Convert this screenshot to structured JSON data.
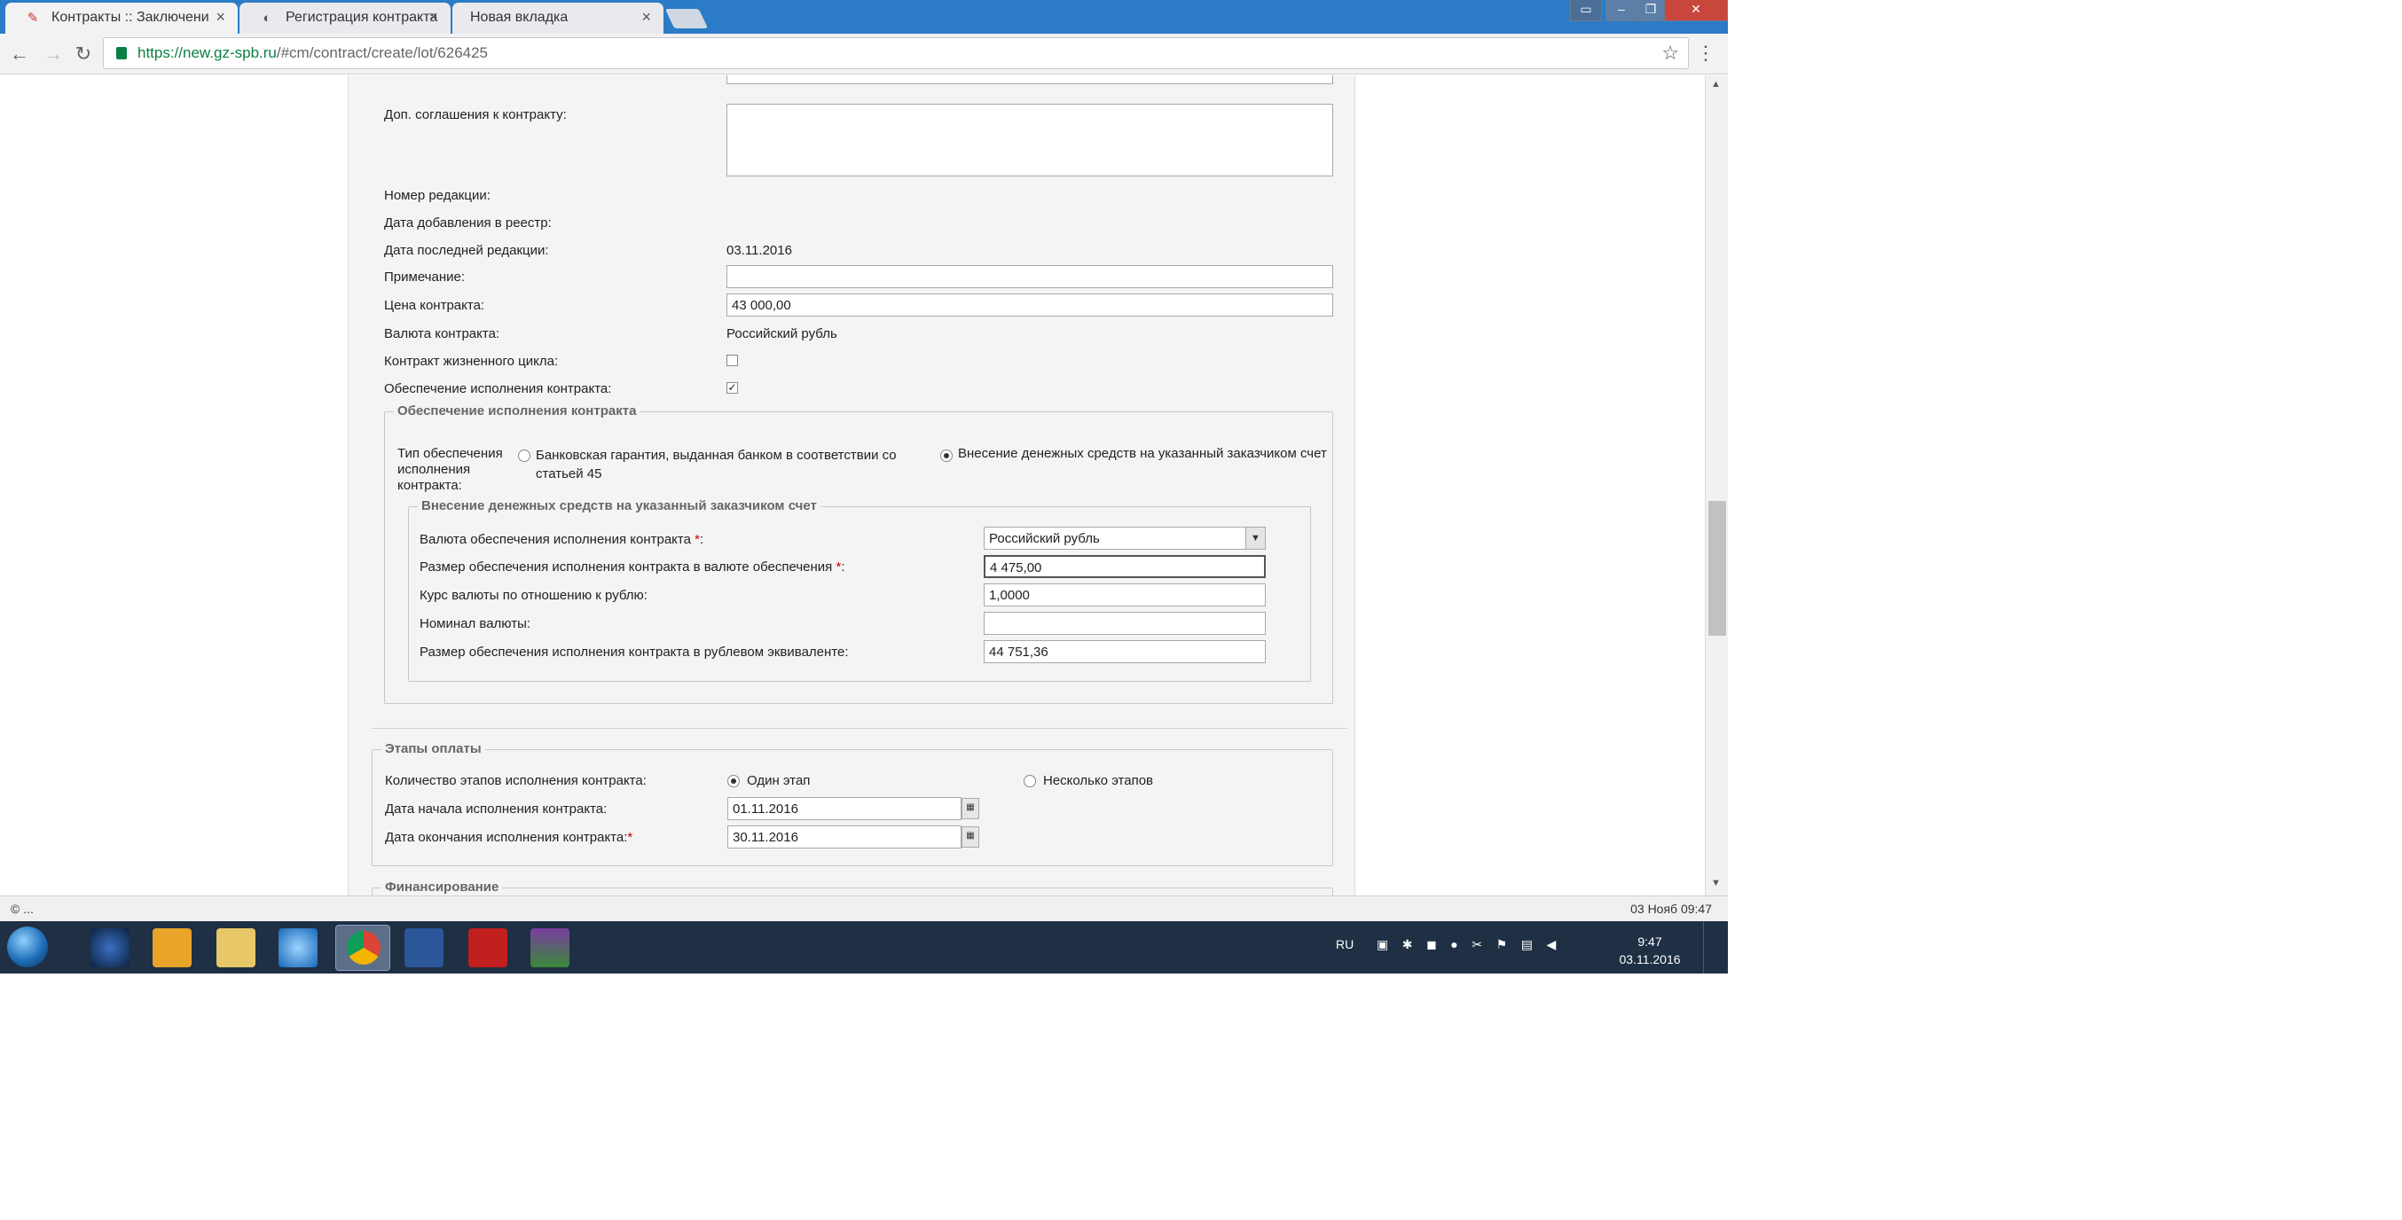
{
  "browser": {
    "tabs": [
      {
        "title": "Контракты :: Заключени",
        "active": true,
        "icon": "contract-favicon-icon"
      },
      {
        "title": "Регистрация контракта",
        "active": false,
        "icon": "globe-favicon-icon"
      },
      {
        "title": "Новая вкладка",
        "active": false,
        "icon": ""
      }
    ],
    "url_host": "https://new.gz-spb.ru",
    "url_path": "/#cm/contract/create/lot/626425"
  },
  "form": {
    "dop_label": "Доп. соглашения к контракту:",
    "nomer_label": "Номер редакции:",
    "data_dob_label": "Дата добавления в реестр:",
    "data_posl_label": "Дата последней редакции:",
    "data_posl_value": "03.11.2016",
    "primechanie_label": "Примечание:",
    "primechanie_value": "",
    "cena_label": "Цена контракта:",
    "cena_value": "43 000,00",
    "valuta_label": "Валюта контракта:",
    "valuta_value": "Российский рубль",
    "zhizn_label": "Контракт жизненного цикла:",
    "zhizn_checked": false,
    "obesp_label": "Обеспечение исполнения контракта:",
    "obesp_checked": true
  },
  "security": {
    "legend": "Обеспечение исполнения контракта",
    "type_label": "Тип обеспечения исполнения контракта:",
    "option1": "Банковская гарантия, выданная банком в соответствии со статьей 45",
    "option2": "Внесение денежных средств на указанный заказчиком счет",
    "selected": "option2",
    "inner_legend": "Внесение денежных средств на указанный заказчиком счет",
    "currency_label": "Валюта обеспечения исполнения контракта",
    "currency_value": "Российский рубль",
    "amount_label": "Размер обеспечения исполнения контракта в валюте обеспечения",
    "amount_value": "4 475,00",
    "rate_label": "Курс валюты по отношению к рублю:",
    "rate_value": "1,0000",
    "nominal_label": "Номинал валюты:",
    "nominal_value": "",
    "rub_label": "Размер обеспечения исполнения контракта в рублевом эквиваленте:",
    "rub_value": "44 751,36",
    "required_mark": "*",
    "colon": ":"
  },
  "payment": {
    "legend": "Этапы оплаты",
    "stages_label": "Количество этапов исполнения контракта:",
    "stage_one": "Один этап",
    "stage_many": "Несколько этапов",
    "selected": "stage_one",
    "start_label": "Дата начала исполнения контракта:",
    "start_value": "01.11.2016",
    "end_label": "Дата окончания исполнения контракта:",
    "end_value": "30.11.2016"
  },
  "financing": {
    "legend": "Финансирование"
  },
  "status": {
    "left": "© ...",
    "right": "03 Нояб 09:47"
  },
  "taskbar": {
    "lang": "RU",
    "time": "9:47",
    "date": "03.11.2016",
    "apps": [
      "start-orb-icon",
      "app-globe-icon",
      "outlook-icon",
      "explorer-folder-icon",
      "internet-explorer-icon",
      "chrome-icon",
      "word-icon",
      "red-app-icon",
      "flag-app-icon"
    ]
  }
}
